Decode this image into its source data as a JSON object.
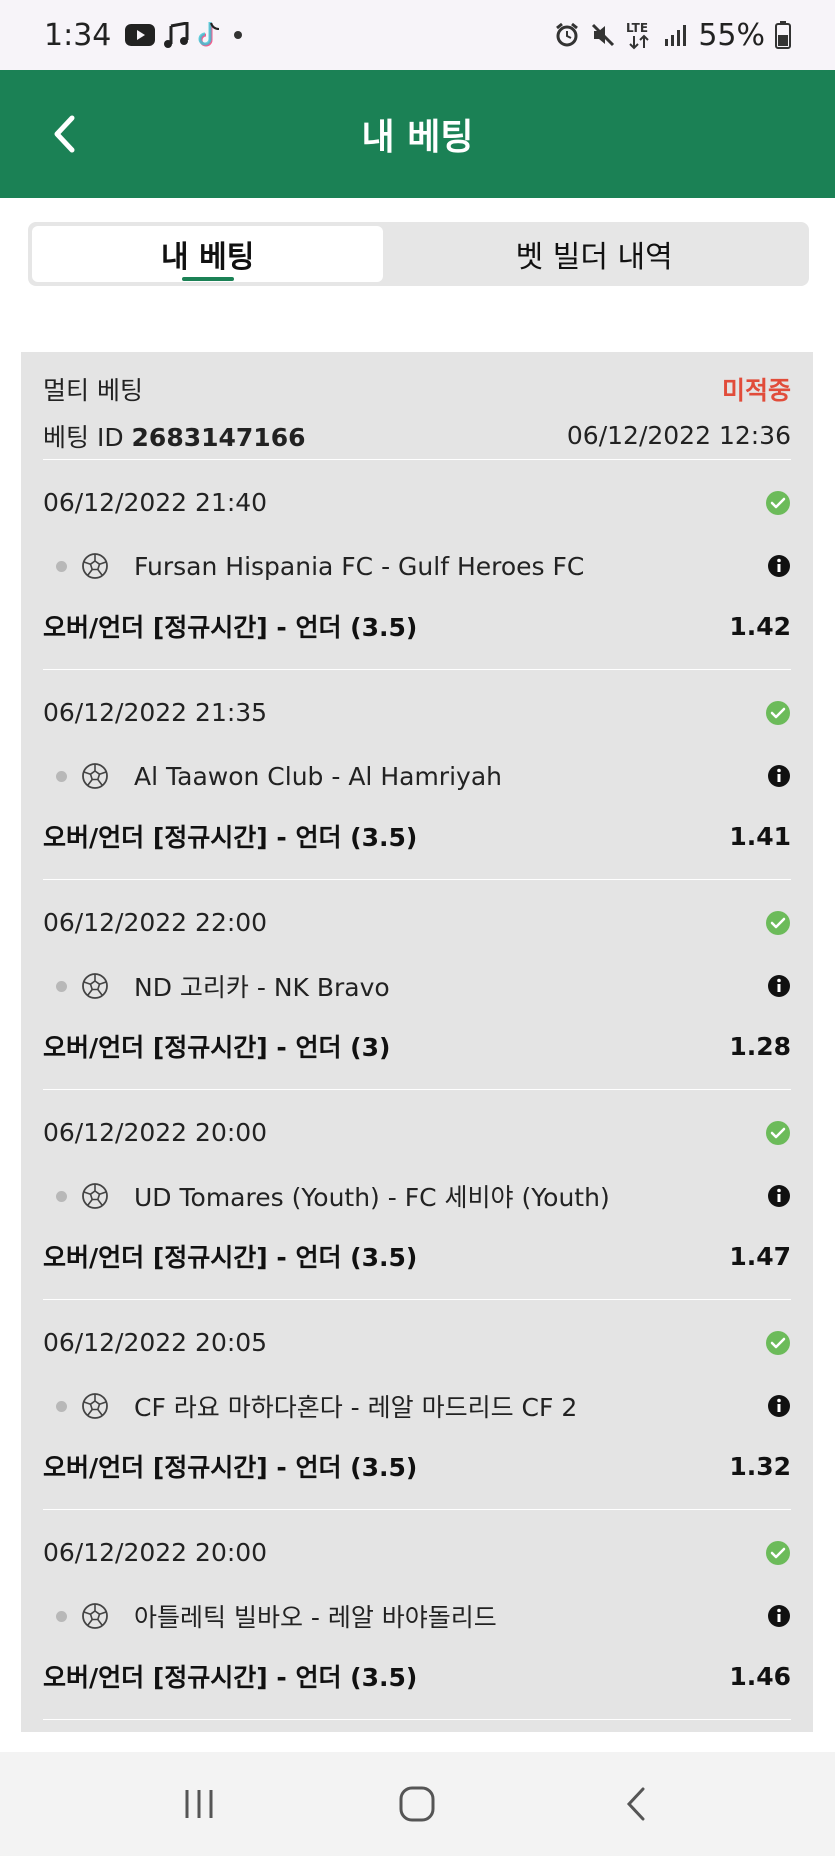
{
  "status_bar": {
    "time": "1:34",
    "battery": "55%",
    "network": "LTE"
  },
  "header": {
    "title": "내 베팅"
  },
  "tabs": [
    {
      "label": "내 베팅",
      "active": true
    },
    {
      "label": "벳 빌더 내역",
      "active": false
    }
  ],
  "bet": {
    "type": "멀티 베팅",
    "status": "미적중",
    "id_label": "베팅 ID",
    "id": "2683147166",
    "placed_at": "06/12/2022 12:36",
    "selections": [
      {
        "datetime": "06/12/2022 21:40",
        "match": "Fursan Hispania FC - Gulf Heroes FC",
        "market": "오버/언더 [정규시간] - 언더 (3.5)",
        "odds": "1.42"
      },
      {
        "datetime": "06/12/2022 21:35",
        "match": "Al Taawon Club - Al Hamriyah",
        "market": "오버/언더 [정규시간] - 언더 (3.5)",
        "odds": "1.41"
      },
      {
        "datetime": "06/12/2022 22:00",
        "match": "ND 고리카 - NK Bravo",
        "market": "오버/언더 [정규시간] - 언더 (3)",
        "odds": "1.28"
      },
      {
        "datetime": "06/12/2022 20:00",
        "match": "UD Tomares (Youth) - FC 세비야 (Youth)",
        "market": "오버/언더 [정규시간] - 언더 (3.5)",
        "odds": "1.47"
      },
      {
        "datetime": "06/12/2022 20:05",
        "match": "CF 라요 마하다혼다 - 레알 마드리드 CF 2",
        "market": "오버/언더 [정규시간] - 언더 (3.5)",
        "odds": "1.32"
      },
      {
        "datetime": "06/12/2022 20:00",
        "match": "아틀레틱 빌바오 - 레알 바야돌리드",
        "market": "오버/언더 [정규시간] - 언더 (3.5)",
        "odds": "1.46"
      }
    ]
  },
  "colors": {
    "brand_green": "#1b8155",
    "lost_red": "#e14c3a",
    "check_green": "#6cbb5a"
  }
}
